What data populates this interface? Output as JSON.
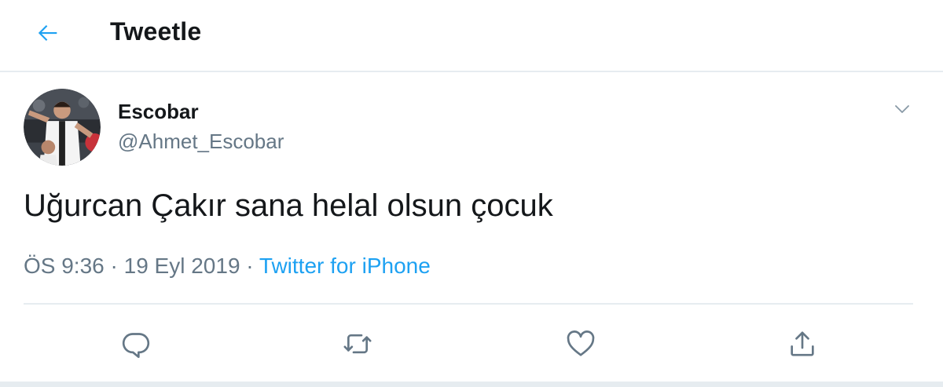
{
  "header": {
    "title": "Tweetle",
    "back_icon": "arrow-left-icon"
  },
  "tweet": {
    "author": {
      "display_name": "Escobar",
      "handle": "@Ahmet_Escobar"
    },
    "text": "Uğurcan Çakır sana helal olsun çocuk",
    "meta": {
      "time": "ÖS 9:36",
      "separator": " · ",
      "date": "19 Eyl 2019",
      "source": "Twitter for iPhone"
    },
    "actions": [
      "reply-icon",
      "retweet-icon",
      "like-icon",
      "share-icon"
    ]
  },
  "colors": {
    "accent": "#1da1f2",
    "text_primary": "#14171a",
    "text_secondary": "#657786",
    "border": "#e6ecf0"
  }
}
